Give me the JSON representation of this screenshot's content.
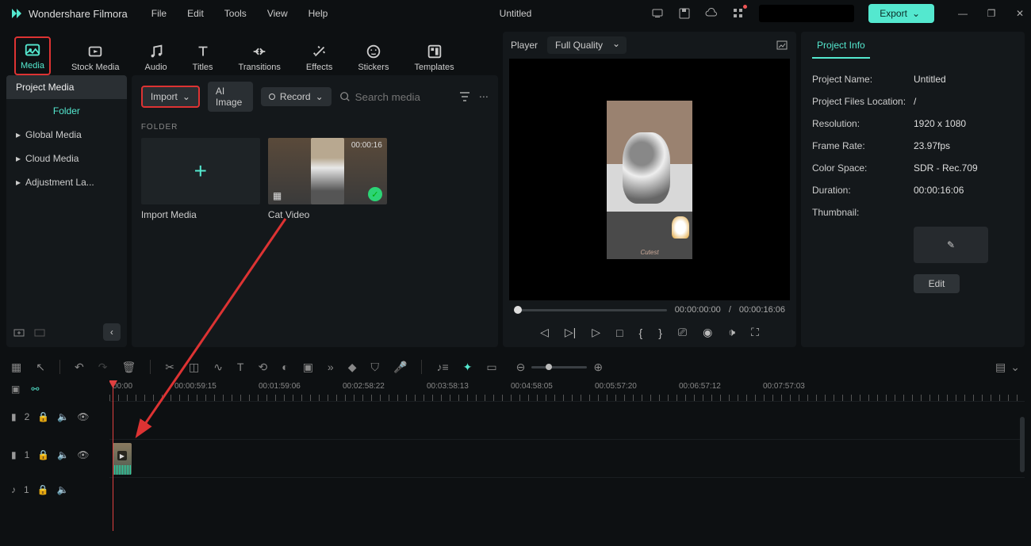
{
  "app_name": "Wondershare Filmora",
  "menu": [
    "File",
    "Edit",
    "Tools",
    "View",
    "Help"
  ],
  "doc_title": "Untitled",
  "export_label": "Export",
  "mode_tabs": [
    {
      "label": "Media",
      "active": true
    },
    {
      "label": "Stock Media"
    },
    {
      "label": "Audio"
    },
    {
      "label": "Titles"
    },
    {
      "label": "Transitions"
    },
    {
      "label": "Effects"
    },
    {
      "label": "Stickers"
    },
    {
      "label": "Templates"
    }
  ],
  "media_side": {
    "header": "Project Media",
    "folder_label": "Folder",
    "items": [
      "Global Media",
      "Cloud Media",
      "Adjustment La..."
    ]
  },
  "media_toolbar": {
    "import": "Import",
    "ai_image": "AI Image",
    "record": "Record",
    "search_placeholder": "Search media"
  },
  "media_folder_label": "FOLDER",
  "media_cards": [
    {
      "label": "Import Media",
      "type": "add"
    },
    {
      "label": "Cat Video",
      "type": "clip",
      "duration": "00:00:16"
    }
  ],
  "player": {
    "tab": "Player",
    "quality": "Full Quality",
    "current": "00:00:00:00",
    "sep": "/",
    "total": "00:00:16:06",
    "overlay_text": "Cutest"
  },
  "project_info": {
    "tab": "Project Info",
    "rows": [
      {
        "k": "Project Name:",
        "v": "Untitled"
      },
      {
        "k": "Project Files Location:",
        "v": "/"
      },
      {
        "k": "Resolution:",
        "v": "1920 x 1080"
      },
      {
        "k": "Frame Rate:",
        "v": "23.97fps"
      },
      {
        "k": "Color Space:",
        "v": "SDR - Rec.709"
      },
      {
        "k": "Duration:",
        "v": "00:00:16:06"
      },
      {
        "k": "Thumbnail:",
        "v": ""
      }
    ],
    "edit": "Edit"
  },
  "ruler": [
    "00:00",
    "00:00:59:15",
    "00:01:59:06",
    "00:02:58:22",
    "00:03:58:13",
    "00:04:58:05",
    "00:05:57:20",
    "00:06:57:12",
    "00:07:57:03"
  ],
  "tracks": {
    "v2": "2",
    "v1": "1",
    "a1": "1"
  }
}
